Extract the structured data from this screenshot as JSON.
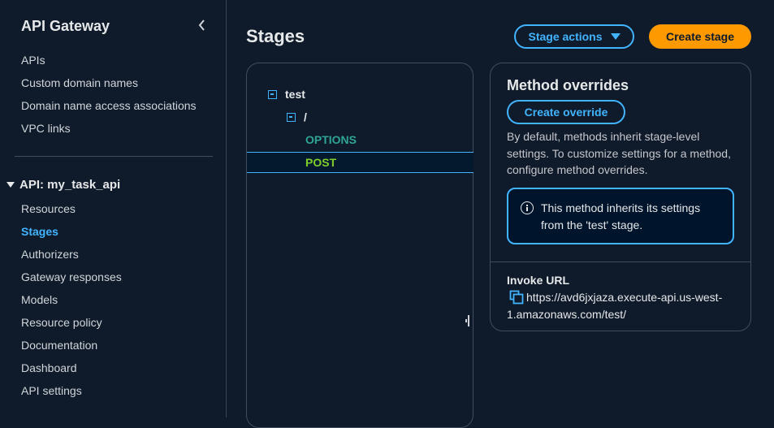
{
  "sidebar": {
    "title": "API Gateway",
    "top_items": [
      {
        "label": "APIs"
      },
      {
        "label": "Custom domain names"
      },
      {
        "label": "Domain name access associations"
      },
      {
        "label": "VPC links"
      }
    ],
    "section_label": "API: my_task_api",
    "api_items": [
      {
        "label": "Resources",
        "active": false
      },
      {
        "label": "Stages",
        "active": true
      },
      {
        "label": "Authorizers",
        "active": false
      },
      {
        "label": "Gateway responses",
        "active": false
      },
      {
        "label": "Models",
        "active": false
      },
      {
        "label": "Resource policy",
        "active": false
      },
      {
        "label": "Documentation",
        "active": false
      },
      {
        "label": "Dashboard",
        "active": false
      },
      {
        "label": "API settings",
        "active": false
      }
    ]
  },
  "header": {
    "title": "Stages",
    "stage_actions_label": "Stage actions",
    "create_stage_label": "Create stage"
  },
  "tree": {
    "stage_name": "test",
    "resource_path": "/",
    "methods": [
      {
        "label": "OPTIONS",
        "color": "#2ea597",
        "selected": false
      },
      {
        "label": "POST",
        "color": "#7ccf2b",
        "selected": true
      }
    ]
  },
  "details": {
    "title": "Method overrides",
    "create_override_label": "Create override",
    "description": "By default, methods inherit stage-level settings. To customize settings for a method, configure method overrides.",
    "info_message": "This method inherits its settings from the 'test' stage.",
    "invoke_url_label": "Invoke URL",
    "invoke_url_line1": "https://avd6jxjaza.execute-api.us-west-",
    "invoke_url_line2": "1.amazonaws.com/test/"
  },
  "colors": {
    "accent": "#42b4ff",
    "primary_button": "#ff9900",
    "background": "#0f1b2a"
  }
}
